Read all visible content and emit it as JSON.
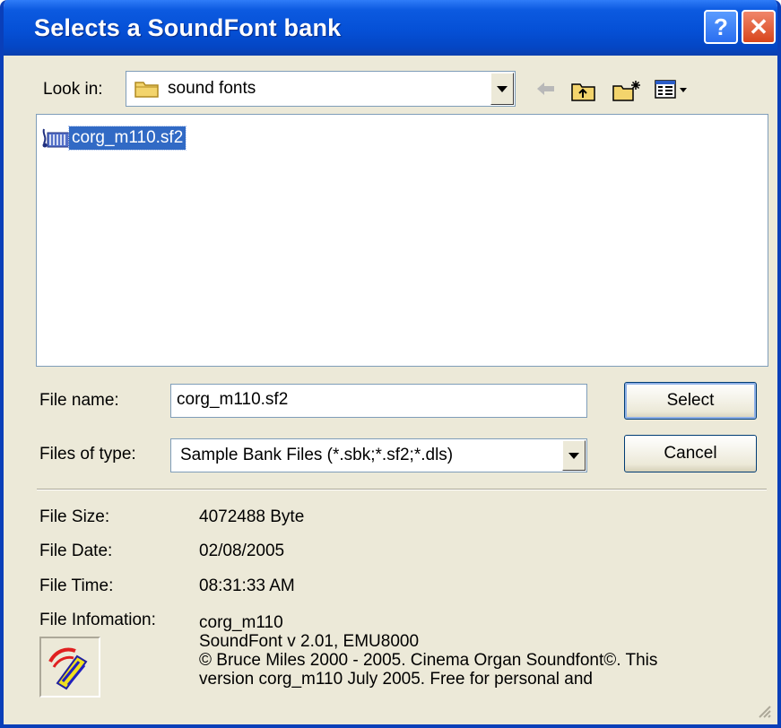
{
  "window": {
    "title": "Selects a SoundFont bank",
    "help_button": "?",
    "close_button": "✕"
  },
  "look_in": {
    "label": "Look in:",
    "value": "sound fonts",
    "folder_icon": "folder-icon"
  },
  "toolbar": {
    "icons": [
      "back-arrow-icon",
      "up-folder-icon",
      "new-folder-icon",
      "view-menu-icon"
    ]
  },
  "file_list": {
    "items": [
      {
        "name": "corg_m110.sf2",
        "icon": "soundfont-file-icon",
        "selected": true
      }
    ]
  },
  "file_name": {
    "label": "File name:",
    "value": "corg_m110.sf2"
  },
  "file_type": {
    "label": "Files of type:",
    "value": "Sample Bank Files (*.sbk;*.sf2;*.dls)"
  },
  "buttons": {
    "select": "Select",
    "cancel": "Cancel"
  },
  "info": {
    "size_label": "File Size:",
    "size_value": "4072488 Byte",
    "date_label": "File Date:",
    "date_value": "02/08/2005",
    "time_label": "File Time:",
    "time_value": "08:31:33 AM",
    "info_label": "File Infomation:",
    "info_line1": "corg_m110",
    "info_line2": "SoundFont v 2.01, EMU8000",
    "info_line3": "© Bruce Miles 2000 - 2005. Cinema Organ Soundfont©. This",
    "info_line4": "version corg_m110 July 2005. Free for personal and"
  },
  "colors": {
    "titlebar": "#0550d6",
    "selection": "#316ac5",
    "dialog_bg": "#ece9d8"
  }
}
